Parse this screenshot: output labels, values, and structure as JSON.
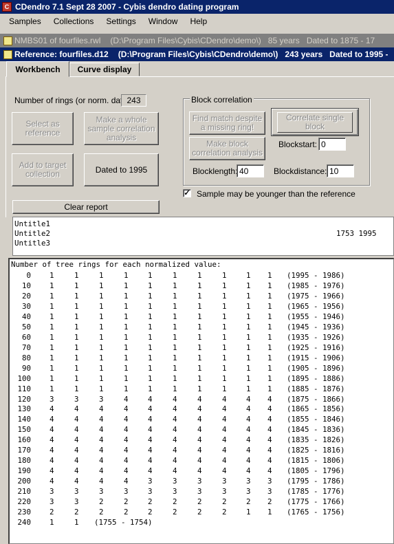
{
  "window": {
    "title": "CDendro 7.1  Sept 28 2007 - Cybis dendro dating program"
  },
  "menu": [
    "Samples",
    "Collections",
    "Settings",
    "Window",
    "Help"
  ],
  "sample_window": {
    "name": "NMBS01 of fourfiles.rwl",
    "path": "(D:\\Program Files\\Cybis\\CDendro\\demo\\)",
    "years": "85 years",
    "dated": "Dated to 1875 - 17"
  },
  "reference_window": {
    "name": "Reference: fourfiles.d12",
    "path": "(D:\\Program Files\\Cybis\\CDendro\\demo\\)",
    "years": "243 years",
    "dated": "Dated to 1995 -"
  },
  "tabs": [
    "Workbench",
    "Curve display"
  ],
  "rings": {
    "label": "Number of rings (or norm. data):",
    "value": "243"
  },
  "buttons": {
    "select_ref": "Select as reference",
    "make_whole": "Make a whole sample correlation analysis",
    "add_target": "Add to target collection",
    "dated": "Dated to 1995",
    "clear_report": "Clear report"
  },
  "block": {
    "title": "Block correlation",
    "find_match": "Find match despite a missing ring!",
    "correlate_single": "Correlate single block",
    "make_block": "Make block correlation analysis",
    "blockstart_label": "Blockstart:",
    "blockstart_value": "0",
    "blocklength_label": "Blocklength:",
    "blocklength_value": "40",
    "blockdistance_label": "Blockdistance:",
    "blockdistance_value": "10"
  },
  "younger": {
    "label": "Sample may be younger than the reference",
    "checked": "✓"
  },
  "list": [
    {
      "name": "Untitle1",
      "years": ""
    },
    {
      "name": "Untitle2",
      "years": "1753 1995"
    },
    {
      "name": "Untitle3",
      "years": ""
    }
  ],
  "report": {
    "header": "Number of tree rings for each normalized value:",
    "rows": [
      {
        "value": "0",
        "counts": [
          "1",
          "1",
          "1",
          "1",
          "1",
          "1",
          "1",
          "1",
          "1",
          "1"
        ],
        "range": "(1995 - 1986)"
      },
      {
        "value": "10",
        "counts": [
          "1",
          "1",
          "1",
          "1",
          "1",
          "1",
          "1",
          "1",
          "1",
          "1"
        ],
        "range": "(1985 - 1976)"
      },
      {
        "value": "20",
        "counts": [
          "1",
          "1",
          "1",
          "1",
          "1",
          "1",
          "1",
          "1",
          "1",
          "1"
        ],
        "range": "(1975 - 1966)"
      },
      {
        "value": "30",
        "counts": [
          "1",
          "1",
          "1",
          "1",
          "1",
          "1",
          "1",
          "1",
          "1",
          "1"
        ],
        "range": "(1965 - 1956)"
      },
      {
        "value": "40",
        "counts": [
          "1",
          "1",
          "1",
          "1",
          "1",
          "1",
          "1",
          "1",
          "1",
          "1"
        ],
        "range": "(1955 - 1946)"
      },
      {
        "value": "50",
        "counts": [
          "1",
          "1",
          "1",
          "1",
          "1",
          "1",
          "1",
          "1",
          "1",
          "1"
        ],
        "range": "(1945 - 1936)"
      },
      {
        "value": "60",
        "counts": [
          "1",
          "1",
          "1",
          "1",
          "1",
          "1",
          "1",
          "1",
          "1",
          "1"
        ],
        "range": "(1935 - 1926)"
      },
      {
        "value": "70",
        "counts": [
          "1",
          "1",
          "1",
          "1",
          "1",
          "1",
          "1",
          "1",
          "1",
          "1"
        ],
        "range": "(1925 - 1916)"
      },
      {
        "value": "80",
        "counts": [
          "1",
          "1",
          "1",
          "1",
          "1",
          "1",
          "1",
          "1",
          "1",
          "1"
        ],
        "range": "(1915 - 1906)"
      },
      {
        "value": "90",
        "counts": [
          "1",
          "1",
          "1",
          "1",
          "1",
          "1",
          "1",
          "1",
          "1",
          "1"
        ],
        "range": "(1905 - 1896)"
      },
      {
        "value": "100",
        "counts": [
          "1",
          "1",
          "1",
          "1",
          "1",
          "1",
          "1",
          "1",
          "1",
          "1"
        ],
        "range": "(1895 - 1886)"
      },
      {
        "value": "110",
        "counts": [
          "1",
          "1",
          "1",
          "1",
          "1",
          "1",
          "1",
          "1",
          "1",
          "1"
        ],
        "range": "(1885 - 1876)"
      },
      {
        "value": "120",
        "counts": [
          "3",
          "3",
          "3",
          "4",
          "4",
          "4",
          "4",
          "4",
          "4",
          "4"
        ],
        "range": "(1875 - 1866)"
      },
      {
        "value": "130",
        "counts": [
          "4",
          "4",
          "4",
          "4",
          "4",
          "4",
          "4",
          "4",
          "4",
          "4"
        ],
        "range": "(1865 - 1856)"
      },
      {
        "value": "140",
        "counts": [
          "4",
          "4",
          "4",
          "4",
          "4",
          "4",
          "4",
          "4",
          "4",
          "4"
        ],
        "range": "(1855 - 1846)"
      },
      {
        "value": "150",
        "counts": [
          "4",
          "4",
          "4",
          "4",
          "4",
          "4",
          "4",
          "4",
          "4",
          "4"
        ],
        "range": "(1845 - 1836)"
      },
      {
        "value": "160",
        "counts": [
          "4",
          "4",
          "4",
          "4",
          "4",
          "4",
          "4",
          "4",
          "4",
          "4"
        ],
        "range": "(1835 - 1826)"
      },
      {
        "value": "170",
        "counts": [
          "4",
          "4",
          "4",
          "4",
          "4",
          "4",
          "4",
          "4",
          "4",
          "4"
        ],
        "range": "(1825 - 1816)"
      },
      {
        "value": "180",
        "counts": [
          "4",
          "4",
          "4",
          "4",
          "4",
          "4",
          "4",
          "4",
          "4",
          "4"
        ],
        "range": "(1815 - 1806)"
      },
      {
        "value": "190",
        "counts": [
          "4",
          "4",
          "4",
          "4",
          "4",
          "4",
          "4",
          "4",
          "4",
          "4"
        ],
        "range": "(1805 - 1796)"
      },
      {
        "value": "200",
        "counts": [
          "4",
          "4",
          "4",
          "4",
          "3",
          "3",
          "3",
          "3",
          "3",
          "3"
        ],
        "range": "(1795 - 1786)"
      },
      {
        "value": "210",
        "counts": [
          "3",
          "3",
          "3",
          "3",
          "3",
          "3",
          "3",
          "3",
          "3",
          "3"
        ],
        "range": "(1785 - 1776)"
      },
      {
        "value": "220",
        "counts": [
          "3",
          "3",
          "2",
          "2",
          "2",
          "2",
          "2",
          "2",
          "2",
          "2"
        ],
        "range": "(1775 - 1766)"
      },
      {
        "value": "230",
        "counts": [
          "2",
          "2",
          "2",
          "2",
          "2",
          "2",
          "2",
          "2",
          "1",
          "1"
        ],
        "range": "(1765 - 1756)"
      },
      {
        "value": "240",
        "counts": [
          "1",
          "1"
        ],
        "range": "(1755 - 1754)"
      }
    ]
  }
}
